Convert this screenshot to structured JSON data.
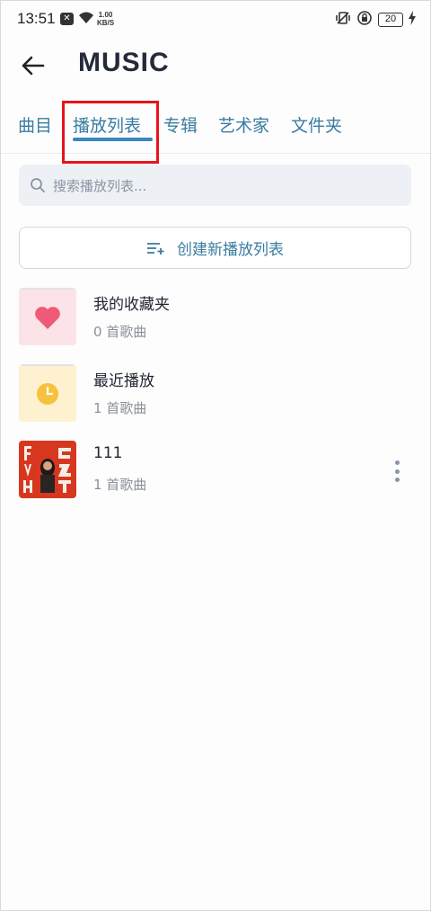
{
  "status": {
    "time": "13:51",
    "speed_value": "1.00",
    "speed_unit": "KB/S",
    "battery": "20"
  },
  "header": {
    "title": "MUSIC"
  },
  "tabs": [
    {
      "label": "曲目"
    },
    {
      "label": "播放列表"
    },
    {
      "label": "专辑"
    },
    {
      "label": "艺术家"
    },
    {
      "label": "文件夹"
    }
  ],
  "active_tab": "播放列表",
  "search": {
    "placeholder": "搜索播放列表..."
  },
  "create_button": {
    "label": "创建新播放列表"
  },
  "playlists": [
    {
      "name": "我的收藏夹",
      "count": "0 首歌曲",
      "icon": "heart-icon"
    },
    {
      "name": "最近播放",
      "count": "1 首歌曲",
      "icon": "clock-icon"
    },
    {
      "name": "111",
      "count": "1 首歌曲",
      "icon": "album-cover"
    }
  ],
  "colors": {
    "accent": "#3a86c0",
    "tab_text": "#3a7ca0",
    "highlight_box": "#e8141b"
  }
}
